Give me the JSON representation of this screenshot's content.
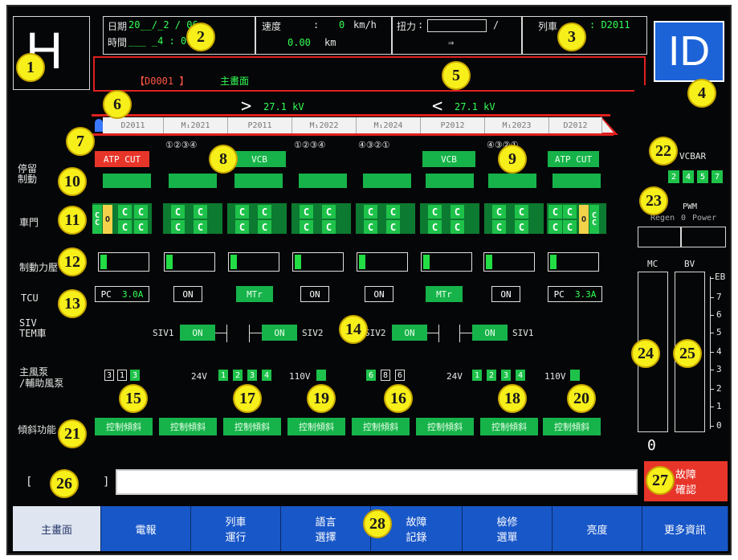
{
  "header": {
    "logo_left": "H",
    "date_label": "日期",
    "date_value": "20__/_2 / 06",
    "time_label": "時間",
    "time_value": "___ _4 : 09",
    "speed_label": "速度",
    "speed_value": "0",
    "speed_unit": "km/h",
    "distance_value": "0.00",
    "distance_unit": "km",
    "torque_label": "扭力",
    "torque_sep": "/",
    "direction_arrow": "⇒",
    "train_label": "列車",
    "train_value": ": D2011",
    "logo_right": "ID",
    "page_code": "【D0001 】",
    "page_title": "主畫面"
  },
  "voltage": {
    "left": "27.1 kV",
    "right": "27.1 kV"
  },
  "cars": [
    "D2011",
    "M₁2021",
    "P2011",
    "M₁2022",
    "M₁2024",
    "P2012",
    "M₁2023",
    "D2012"
  ],
  "car_numbers": [
    "①②③④",
    "①②③④",
    "④③②①",
    "④③②①"
  ],
  "brake_row": {
    "atp_left": "ATP CUT",
    "vcb_left": "VCB",
    "vcb_right": "VCB",
    "atp_right": "ATP CUT"
  },
  "row_labels": {
    "stop": "停留\n制動",
    "door": "車門",
    "brake_pressure": "制動力壓",
    "tcu": "TCU",
    "siv": "SIV\nTEM車",
    "pump": "主風泵\n/輔助風泵",
    "tilt": "傾斜功能"
  },
  "door_char": "C",
  "door_open_char": "O",
  "tcu": [
    "PC",
    "3.0A",
    "ON",
    "MTr",
    "ON",
    "ON",
    "MTr",
    "ON",
    "PC",
    "3.3A"
  ],
  "siv": {
    "siv1": "SIV1",
    "siv2": "SIV2",
    "on": "ON"
  },
  "pump": {
    "left_nums": [
      "3",
      "1",
      "3"
    ],
    "v24": "24V",
    "v110": "110V",
    "group_a": [
      "1",
      "2",
      "3",
      "4"
    ],
    "group_b": [
      "6",
      "8",
      "6"
    ]
  },
  "tilt_label": "控制傾斜",
  "right_panel": {
    "vcbar": "VCBAR",
    "vcbar_nums": [
      "2",
      "4",
      "5",
      "7"
    ],
    "pwm": "PWM",
    "regen": "Regen",
    "zero": "0",
    "power": "Power",
    "mc": "MC",
    "bv": "BV",
    "eb": "EB",
    "scale": [
      "7",
      "6",
      "5",
      "4",
      "3",
      "2",
      "1",
      "0"
    ],
    "mc_value": "0"
  },
  "message": {
    "bracket_open": "[",
    "bracket_close": "]",
    "text": ""
  },
  "fault_confirm": "故障\n確認",
  "nav": [
    "主畫面",
    "電報",
    "列車\n運行",
    "語言\n選擇",
    "故障\n記錄",
    "檢修\n選單",
    "亮度",
    "更多資訊"
  ],
  "callouts": [
    "1",
    "2",
    "3",
    "4",
    "5",
    "6",
    "7",
    "8",
    "9",
    "10",
    "11",
    "12",
    "13",
    "14",
    "15",
    "16",
    "17",
    "18",
    "19",
    "20",
    "21",
    "22",
    "23",
    "24",
    "25",
    "26",
    "27",
    "28"
  ],
  "colors": {
    "background": "#050607",
    "accent_green": "#16b34a",
    "alert_red": "#e8352a",
    "nav_blue": "#1857c8",
    "callout_yellow": "#f7ef1a"
  }
}
